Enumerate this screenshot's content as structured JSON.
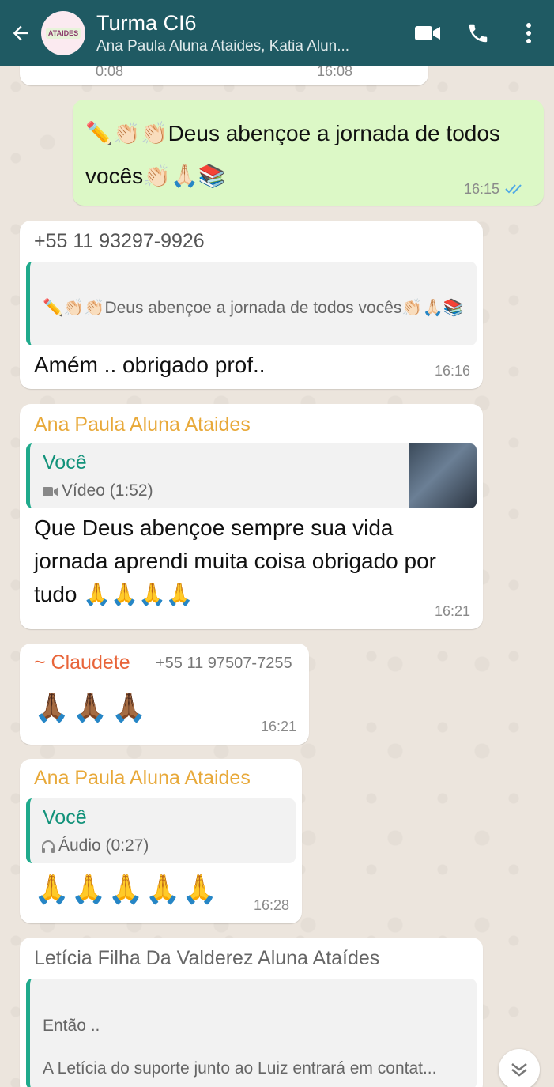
{
  "header": {
    "title": "Turma CI6",
    "subtitle": "Ana Paula Aluna Ataides, Katia Alun...",
    "avatar_text": "ATAIDES",
    "colors": {
      "bar": "#1f5a63"
    }
  },
  "top_partial": {
    "duration": "0:08",
    "time": "16:08"
  },
  "msg_out": {
    "text": "✏️👏🏻👏🏻Deus abençoe a jornada de todos vocês👏🏻🙏🏻📚",
    "time": "16:15"
  },
  "msg1": {
    "sender": "+55 11 93297-9926",
    "quote_text": "✏️👏🏻👏🏻Deus abençoe a jornada de todos vocês👏🏻🙏🏻📚",
    "text": "Amém .. obrigado prof..",
    "time": "16:16"
  },
  "msg2": {
    "sender": "Ana Paula Aluna Ataides",
    "quote_sender": "Você",
    "quote_text": "Vídeo (1:52)",
    "text": "Que Deus abençoe sempre sua vida jornada aprendi muita coisa obrigado por tudo 🙏🙏🙏🙏",
    "time": "16:21"
  },
  "msg3": {
    "sender": "~ Claudete",
    "phone": "+55 11 97507-7255",
    "text": "🙏🏾🙏🏾🙏🏾",
    "time": "16:21"
  },
  "msg4": {
    "sender": "Ana Paula Aluna Ataides",
    "quote_sender": "Você",
    "quote_text": "Áudio (0:27)",
    "text": "🙏🙏🙏🙏🙏",
    "time": "16:28"
  },
  "msg5": {
    "sender": "Letícia Filha Da Valderez Aluna Ataídes",
    "quote_line1": "Então ..",
    "quote_line2": "A Letícia do suporte junto ao Luiz entrará em contat..."
  },
  "colors": {
    "sender_orange": "#e8a93a",
    "sender_claudete": "#e8653a",
    "quote_green": "#12927a",
    "read_tick": "#4fa9e6"
  },
  "icons": [
    "back-arrow-icon",
    "video-call-icon",
    "phone-icon",
    "more-vert-icon",
    "video-icon",
    "headphone-icon",
    "double-tick-icon",
    "chevron-down-icon"
  ]
}
